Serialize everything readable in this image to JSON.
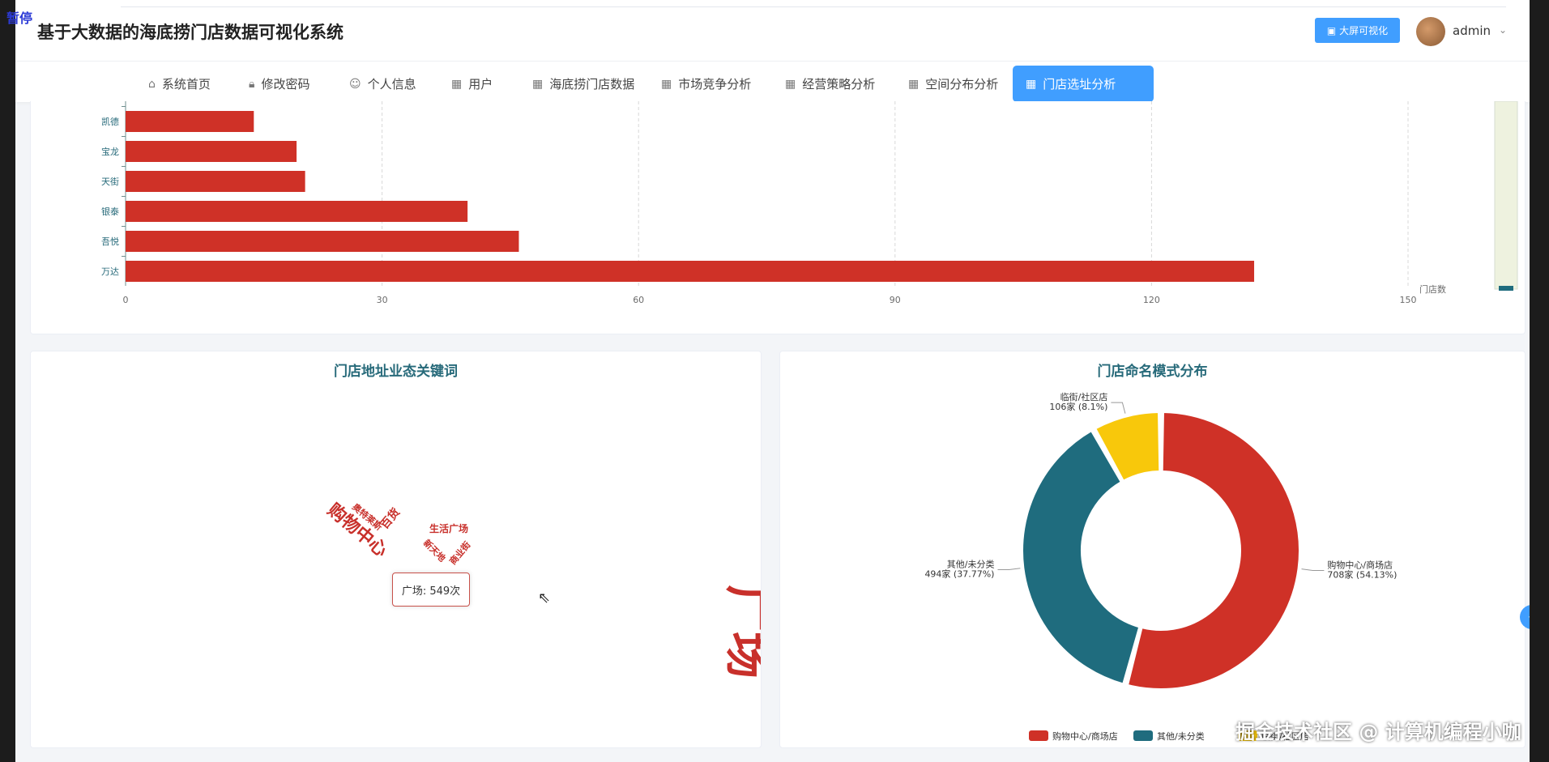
{
  "overlay": {
    "pause_label": "暂停",
    "watermark": "掘金技术社区 @ 计算机编程小咖"
  },
  "header": {
    "title": "基于大数据的海底捞门店数据可视化系统",
    "bigscreen_button": "大屏可视化",
    "username": "admin"
  },
  "nav": {
    "items": [
      {
        "label": "系统首页",
        "icon": "home-icon"
      },
      {
        "label": "修改密码",
        "icon": "lock-icon"
      },
      {
        "label": "个人信息",
        "icon": "user-icon"
      },
      {
        "label": "用户",
        "icon": "grid-icon"
      },
      {
        "label": "海底捞门店数据",
        "icon": "grid-icon"
      },
      {
        "label": "市场竞争分析",
        "icon": "grid-icon"
      },
      {
        "label": "经营策略分析",
        "icon": "grid-icon"
      },
      {
        "label": "空间分布分析",
        "icon": "grid-icon"
      },
      {
        "label": "门店选址分析",
        "icon": "grid-icon",
        "active": true
      }
    ]
  },
  "bar_card": {
    "axis_unit": "门店数"
  },
  "wordcloud_card": {
    "title": "门店地址业态关键词",
    "tooltip": "广场: 549次",
    "words": [
      "广场",
      "购物中心",
      "百货",
      "奥特莱斯",
      "生活广场",
      "新天地",
      "商业街"
    ]
  },
  "pie_card": {
    "title": "门店命名模式分布"
  },
  "colors": {
    "bar": "#cf3127",
    "teal": "#1f6c7e",
    "yellow": "#f8c80b",
    "accent": "#409eff"
  },
  "chart_data": [
    {
      "type": "bar",
      "orientation": "horizontal",
      "categories": [
        "凯德",
        "宝龙",
        "天街",
        "银泰",
        "吾悦",
        "万达"
      ],
      "values": [
        15,
        20,
        21,
        40,
        46,
        132
      ],
      "xlabel": "门店数",
      "xlim": [
        0,
        150
      ],
      "xticks": [
        0,
        30,
        60,
        90,
        120,
        150
      ],
      "grid": true
    },
    {
      "type": "pie",
      "donut": true,
      "slices": [
        {
          "name": "购物中心/商场店",
          "label": "708家 (54.13%)",
          "value": 708,
          "color": "#cf3127"
        },
        {
          "name": "其他/未分类",
          "label": "494家 (37.77%)",
          "value": 494,
          "color": "#1f6c7e"
        },
        {
          "name": "临街/社区店",
          "label": "106家 (8.1%)",
          "value": 106,
          "color": "#f8c80b"
        }
      ],
      "legend": [
        "购物中心/商场店",
        "其他/未分类",
        "临街/社区店"
      ],
      "legend_position": "bottom"
    }
  ]
}
